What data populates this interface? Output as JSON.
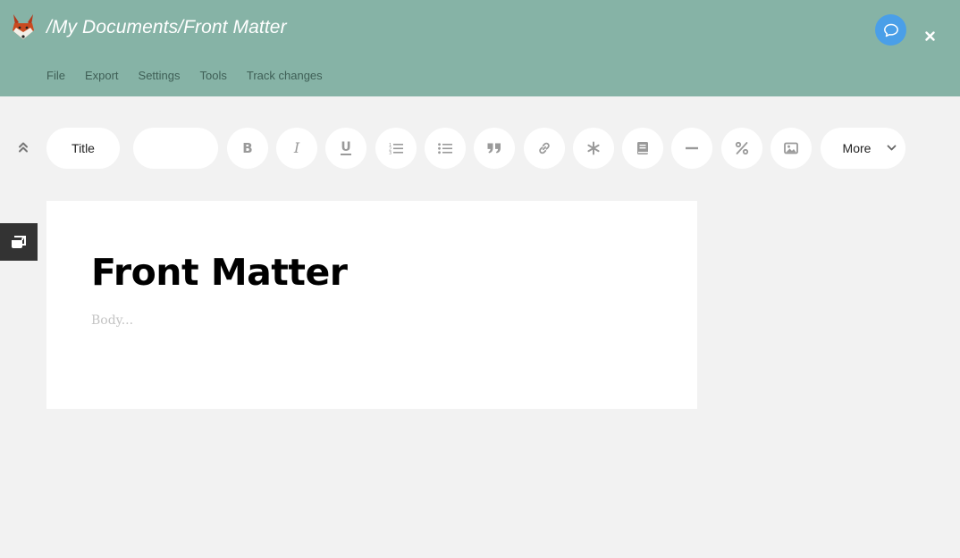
{
  "header": {
    "path": "/My Documents/Front Matter",
    "menu": [
      "File",
      "Export",
      "Settings",
      "Tools",
      "Track changes"
    ],
    "icons": {
      "logo": "fox-logo-icon",
      "chat": "chat-bubble-icon",
      "close": "close-icon"
    },
    "colors": {
      "bar": "#86b3a6",
      "chat": "#4a9fe8"
    }
  },
  "toolbar": {
    "style_label": "Title",
    "second_dropdown_value": "",
    "more_label": "More",
    "buttons": [
      "bold-icon",
      "italic-icon",
      "underline-icon",
      "numbered-list-icon",
      "bullet-list-icon",
      "blockquote-icon",
      "link-icon",
      "footnote-icon",
      "citation-icon",
      "horizontal-rule-icon",
      "math-icon",
      "image-icon"
    ]
  },
  "document": {
    "title": "Front Matter",
    "body_placeholder": "Body..."
  }
}
